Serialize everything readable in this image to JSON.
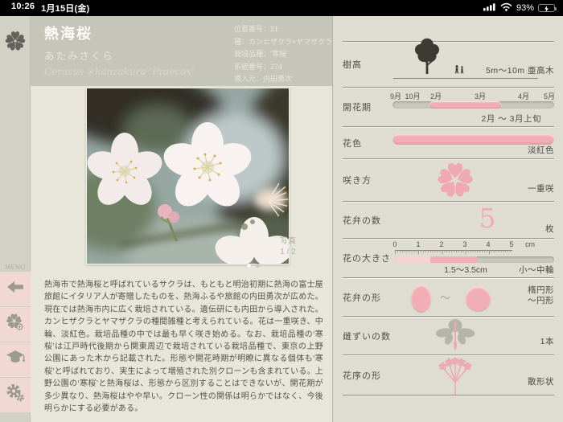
{
  "status_bar": {
    "time": "10:26",
    "date": "1月15日(金)",
    "battery_percent": "93%"
  },
  "sidebar": {
    "menu_label": "MENU"
  },
  "header": {
    "title": "熱海桜",
    "kana": "あたみさくら",
    "latin": "Cerasus ×kanzakura ‘Praecox’",
    "info": [
      "位置番号：21",
      "種：カンヒザクラ×ヤマザクラ",
      "栽培品種：‘寒桜’",
      "系統番号：274",
      "導入元：内田勇次"
    ]
  },
  "photo": {
    "caption_title": "写真",
    "caption_page": "1 / 2"
  },
  "description": "熱海市で熱海桜と呼ばれているサクラは、もともと明治初期に熱海の富士屋旅館にイタリア人が寄贈したものを、熱海ふるや旅館の内田勇次が広めた。現在では熱海市内に広く栽培されている。遺伝研にも内田から導入された。カンヒザクラとヤマザクラの種間雑種と考えられている。花は一重咲き、中輪、淡紅色。栽培品種の中では最も早く咲き始める。なお、栽培品種の‘寒桜’は江戸時代後期から関東周辺で栽培されている栽培品種で、東京の上野公園にあった木から記載された。形態や開花時期が明瞭に異なる個体も‘寒桜’と呼ばれており、実生によって増殖された別クローンも含まれている。上野公園の‘寒桜’と熱海桜は、形態から区別することはできないが、開花期が多少異なり、熱海桜はやや早い。クローン性の関係は明らかではなく、今後明らかにする必要がある。",
  "panel": {
    "height": {
      "label": "樹高",
      "value": "5m〜10m  亜高木"
    },
    "bloom_period": {
      "label": "開花期",
      "months": [
        "9月",
        "10月",
        "2月",
        "3月",
        "4月",
        "5月"
      ],
      "value": "2月 〜 3月上旬"
    },
    "flower_color": {
      "label": "花色",
      "value": "淡紅色"
    },
    "bloom_style": {
      "label": "咲き方",
      "value": "一重咲"
    },
    "petal_count": {
      "label": "花弁の数",
      "number": "5",
      "unit": "枚"
    },
    "flower_size": {
      "label": "花の大きさ",
      "ticks": [
        "0",
        "1",
        "2",
        "3",
        "4",
        "5"
      ],
      "unit": "cm",
      "range": "1.5〜3.5cm",
      "value": "小〜中輪"
    },
    "petal_shape": {
      "label": "花弁の形",
      "tilde": "〜",
      "value_line1": "楕円形",
      "value_line2": "〜円形"
    },
    "pistil_count": {
      "label": "雌ずいの数",
      "value": "1本"
    },
    "inflorescence": {
      "label": "花序の形",
      "value": "散形状"
    }
  },
  "colors": {
    "accent_pink": "#f1aeb4",
    "light_pink": "#f6d2d5",
    "rail_button_pink": "#f1d8d3",
    "panel_bg": "#dfddd1",
    "header_bg": "#c6c5ba",
    "battery_green": "#5bd660"
  }
}
